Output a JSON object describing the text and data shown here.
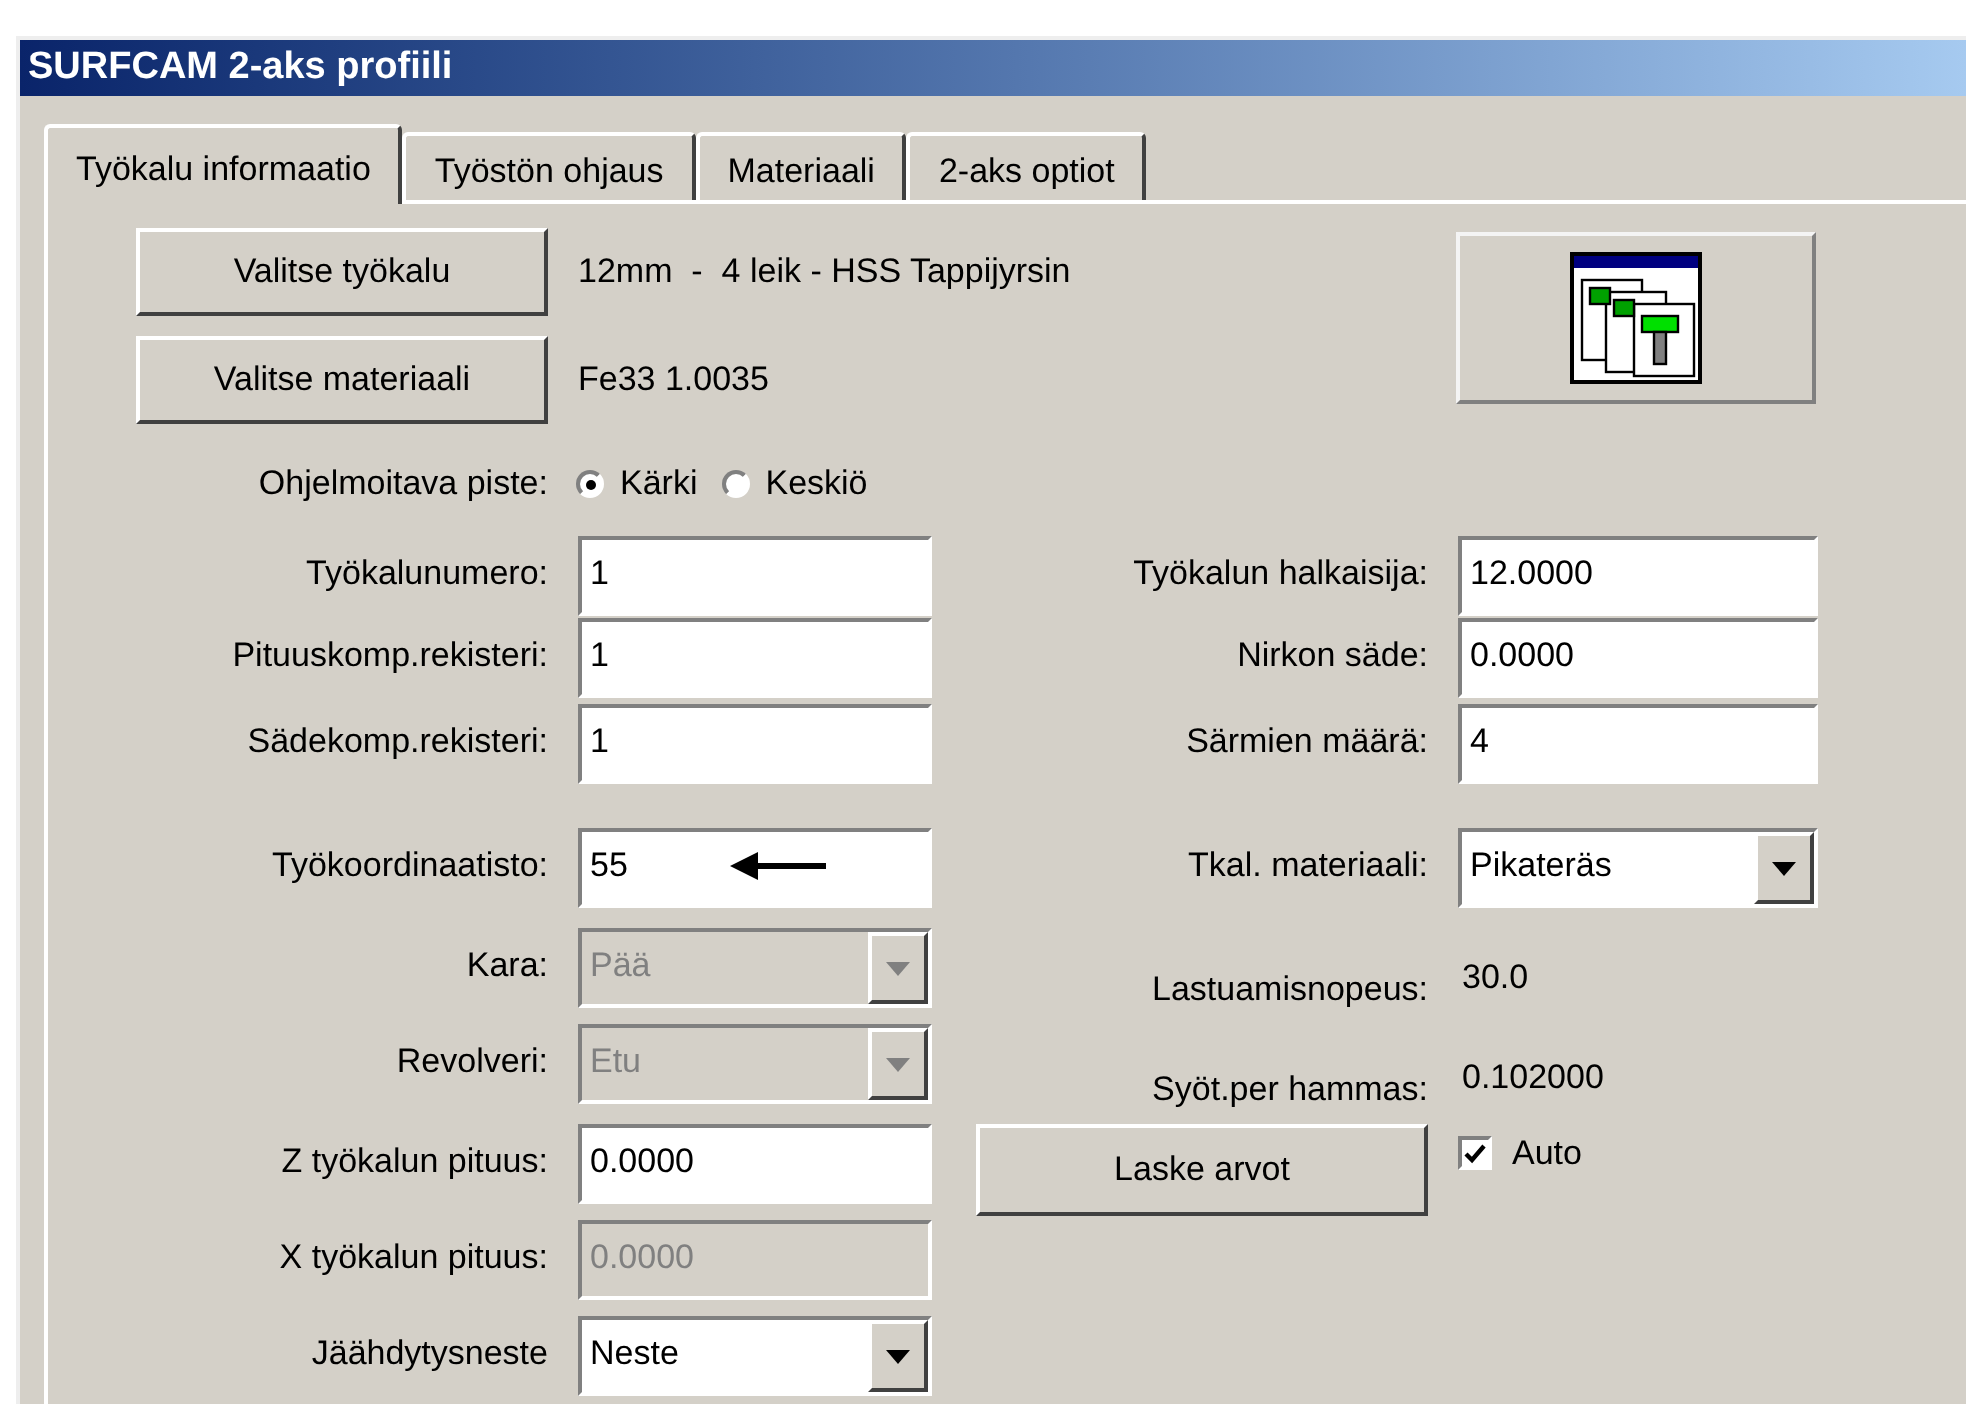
{
  "window": {
    "title": "SURFCAM 2-aks profiili"
  },
  "tabs": [
    {
      "label": "Työkalu informaatio",
      "selected": true
    },
    {
      "label": "Työstön ohjaus",
      "selected": false
    },
    {
      "label": "Materiaali",
      "selected": false
    },
    {
      "label": "2-aks optiot",
      "selected": false
    }
  ],
  "selectors": [
    {
      "button": "Valitse työkalu",
      "value": "12mm  -  4 leik - HSS Tappijyrsin"
    },
    {
      "button": "Valitse materiaali",
      "value": "Fe33 1.0035"
    }
  ],
  "point": {
    "label": "Ohjelmoitava piste:",
    "options": [
      {
        "label": "Kärki",
        "selected": true
      },
      {
        "label": "Keskiö",
        "selected": false
      }
    ]
  },
  "left_fields": [
    {
      "kind": "text",
      "label": "Työkalunumero:",
      "value": "1",
      "disabled": false
    },
    {
      "kind": "text",
      "label": "Pituuskomp.rekisteri:",
      "value": "1",
      "disabled": false
    },
    {
      "kind": "text",
      "label": "Sädekomp.rekisteri:",
      "value": "1",
      "disabled": false
    },
    {
      "kind": "text",
      "label": "Työkoordinaatisto:",
      "value": "55",
      "disabled": false
    },
    {
      "kind": "combo",
      "label": "Kara:",
      "value": "Pää",
      "disabled": true
    },
    {
      "kind": "combo",
      "label": "Revolveri:",
      "value": "Etu",
      "disabled": true
    },
    {
      "kind": "text",
      "label": "Z työkalun pituus:",
      "value": "0.0000",
      "disabled": false
    },
    {
      "kind": "text",
      "label": "X työkalun pituus:",
      "value": "0.0000",
      "disabled": true
    },
    {
      "kind": "combo",
      "label": "Jäähdytysneste",
      "value": "Neste",
      "disabled": false
    }
  ],
  "right_fields": [
    {
      "kind": "text",
      "label": "Työkalun halkaisija:",
      "value": "12.0000"
    },
    {
      "kind": "text",
      "label": "Nirkon säde:",
      "value": "0.0000"
    },
    {
      "kind": "text",
      "label": "Särmien määrä:",
      "value": "4"
    },
    {
      "kind": "combo",
      "label": "Tkal. materiaali:",
      "value": "Pikateräs"
    },
    {
      "kind": "readout",
      "label": "Lastuamisnopeus:",
      "value": "30.0"
    },
    {
      "kind": "readout",
      "label": "Syöt.per hammas:",
      "value": "0.102000"
    }
  ],
  "calc_button": "Laske arvot",
  "auto": {
    "label": "Auto",
    "checked": true
  }
}
